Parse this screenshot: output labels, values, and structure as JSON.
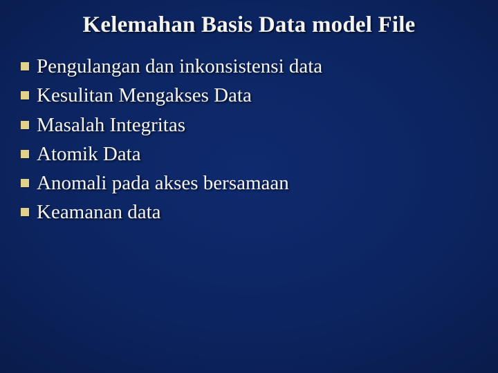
{
  "title": "Kelemahan Basis Data model File",
  "items": [
    "Pengulangan dan inkonsistensi data",
    "Kesulitan Mengakses Data",
    "Masalah Integritas",
    "Atomik Data",
    "Anomali pada akses bersamaan",
    "Keamanan data"
  ]
}
